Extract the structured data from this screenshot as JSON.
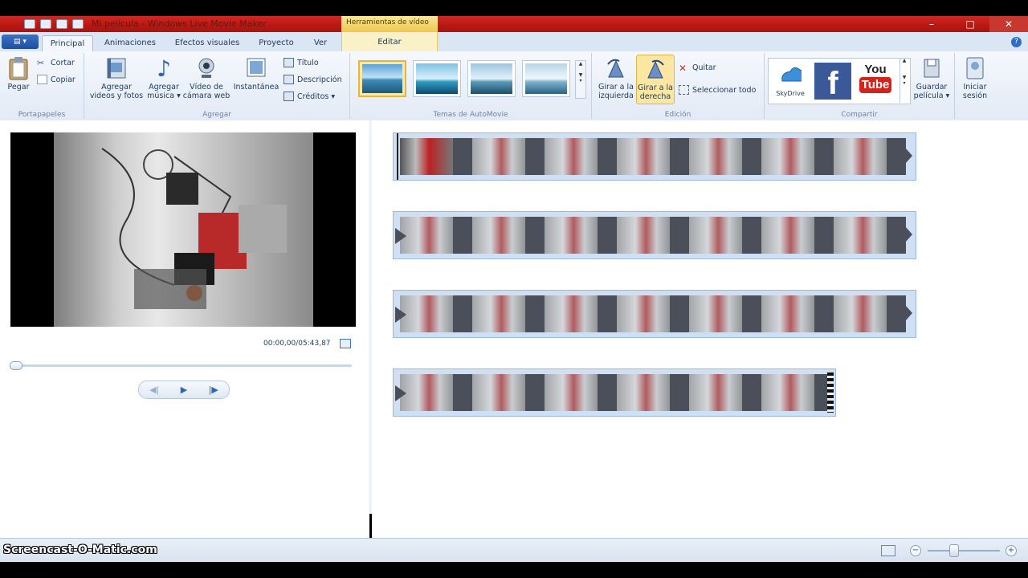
{
  "window": {
    "title": "Mi película - Windows Live Movie Maker",
    "context_tab_header": "Herramientas de vídeo",
    "controls": [
      "–",
      "□",
      "✕"
    ]
  },
  "tabs": [
    {
      "label": "Principal",
      "active": true
    },
    {
      "label": "Animaciones",
      "active": false
    },
    {
      "label": "Efectos visuales",
      "active": false
    },
    {
      "label": "Proyecto",
      "active": false
    },
    {
      "label": "Ver",
      "active": false
    }
  ],
  "context_tab": {
    "label": "Editar"
  },
  "ribbon": {
    "portapapeles": {
      "label": "Portapapeles",
      "pegar": "Pegar",
      "cortar": "Cortar",
      "copiar": "Copiar"
    },
    "agregar": {
      "label": "Agregar",
      "videos_fotos": [
        "Agregar",
        "videos y fotos"
      ],
      "musica": [
        "Agregar",
        "música ▾"
      ],
      "camara": [
        "Vídeo de",
        "cámara web"
      ],
      "instantanea": "Instantánea",
      "titulo": "Título",
      "descripcion": "Descripción",
      "creditos": "Créditos ▾"
    },
    "temas": {
      "label": "Temas de AutoMovie"
    },
    "edicion": {
      "label": "Edición",
      "girar_izq": [
        "Girar a la",
        "izquierda"
      ],
      "girar_der": [
        "Girar a la",
        "derecha"
      ],
      "quitar": "Quitar",
      "seleccionar": "Seleccionar todo"
    },
    "compartir": {
      "label": "Compartir",
      "skydrive": "SkyDrive",
      "youtube": [
        "You",
        "Tube"
      ],
      "guardar": [
        "Guardar",
        "película ▾"
      ],
      "sesion": [
        "Iniciar",
        "sesión"
      ]
    }
  },
  "preview": {
    "timecode": "00:00,00/05:43,87"
  },
  "status": {
    "watermark": "Screencast-O-Matic.com"
  },
  "colors": {
    "accent": "#2e66b6",
    "titlebar": "#c0201a",
    "selected_theme": "#e8b543"
  }
}
